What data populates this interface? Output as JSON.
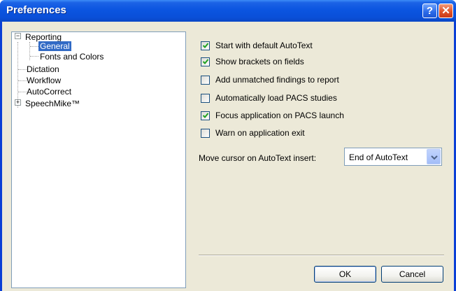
{
  "window": {
    "title": "Preferences",
    "help_label": "?",
    "close_label": "✕"
  },
  "tree": {
    "reporting": "Reporting",
    "general": "General",
    "fonts_colors": "Fonts and Colors",
    "dictation": "Dictation",
    "workflow": "Workflow",
    "autocorrect": "AutoCorrect",
    "speechmike": "SpeechMike™",
    "expanded_glyph": "−",
    "collapsed_glyph": "+"
  },
  "options": [
    {
      "label": "Start with default AutoText",
      "checked": true
    },
    {
      "label": "Show brackets on fields",
      "checked": true
    },
    {
      "label": "Add unmatched findings to report",
      "checked": false
    },
    {
      "label": "Automatically load PACS studies",
      "checked": false
    },
    {
      "label": "Focus application on PACS launch",
      "checked": true
    },
    {
      "label": "Warn on application exit",
      "checked": false
    }
  ],
  "cursor": {
    "label": "Move cursor on AutoText insert:",
    "value": "End of AutoText"
  },
  "buttons": {
    "ok": "OK",
    "cancel": "Cancel"
  },
  "colors": {
    "title_bar": "#0a4fd8",
    "selection": "#316ac5",
    "dialog_bg": "#ece9d8",
    "check": "#21a121"
  },
  "icons": [
    "help-icon",
    "close-icon",
    "checkmark-icon",
    "chevron-down-icon",
    "tree-expander-icon"
  ]
}
